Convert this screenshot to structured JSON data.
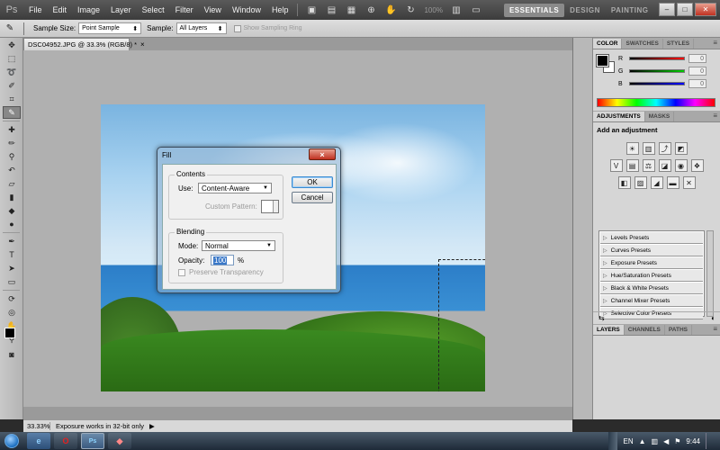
{
  "app": {
    "logo": "Ps"
  },
  "menu": [
    "File",
    "Edit",
    "Image",
    "Layer",
    "Select",
    "Filter",
    "View",
    "Window",
    "Help"
  ],
  "zoom_display": "100%",
  "workspaces": {
    "essentials": "ESSENTIALS",
    "design": "DESIGN",
    "painting": "PAINTING",
    "more": "≫"
  },
  "options": {
    "sample_size_label": "Sample Size:",
    "sample_size_value": "Point Sample",
    "sample_label": "Sample:",
    "sample_value": "All Layers",
    "show_ring_label": "Show Sampling Ring"
  },
  "document": {
    "tab_title": "DSC04952.JPG @ 33.3% (RGB/8) *",
    "close": "×"
  },
  "status": {
    "zoom": "33.33%",
    "message": "Exposure works in 32-bit only",
    "arrow": "▶"
  },
  "color_panel": {
    "tabs": [
      "COLOR",
      "SWATCHES",
      "STYLES"
    ],
    "channels": [
      {
        "label": "R",
        "value": "0"
      },
      {
        "label": "G",
        "value": "0"
      },
      {
        "label": "B",
        "value": "0"
      }
    ]
  },
  "adjustments_panel": {
    "tabs": [
      "ADJUSTMENTS",
      "MASKS"
    ],
    "title": "Add an adjustment",
    "presets": [
      "Levels Presets",
      "Curves Presets",
      "Exposure Presets",
      "Hue/Saturation Presets",
      "Black & White Presets",
      "Channel Mixer Presets",
      "Selective Color Presets"
    ]
  },
  "layers_panel": {
    "tabs": [
      "LAYERS",
      "CHANNELS",
      "PATHS"
    ]
  },
  "dialog": {
    "title": "Fill",
    "close": "×",
    "contents_label": "Contents",
    "use_label": "Use:",
    "use_value": "Content-Aware",
    "custom_pattern_label": "Custom Pattern:",
    "blending_label": "Blending",
    "mode_label": "Mode:",
    "mode_value": "Normal",
    "opacity_label": "Opacity:",
    "opacity_value": "100",
    "opacity_unit": "%",
    "preserve_label": "Preserve Transparency",
    "ok_label": "OK",
    "cancel_label": "Cancel"
  },
  "taskbar": {
    "language": "EN",
    "clock": "9:44",
    "ps_label": "Ps"
  },
  "colors": {
    "accent": "#3a78c8",
    "close_red": "#c03020"
  }
}
